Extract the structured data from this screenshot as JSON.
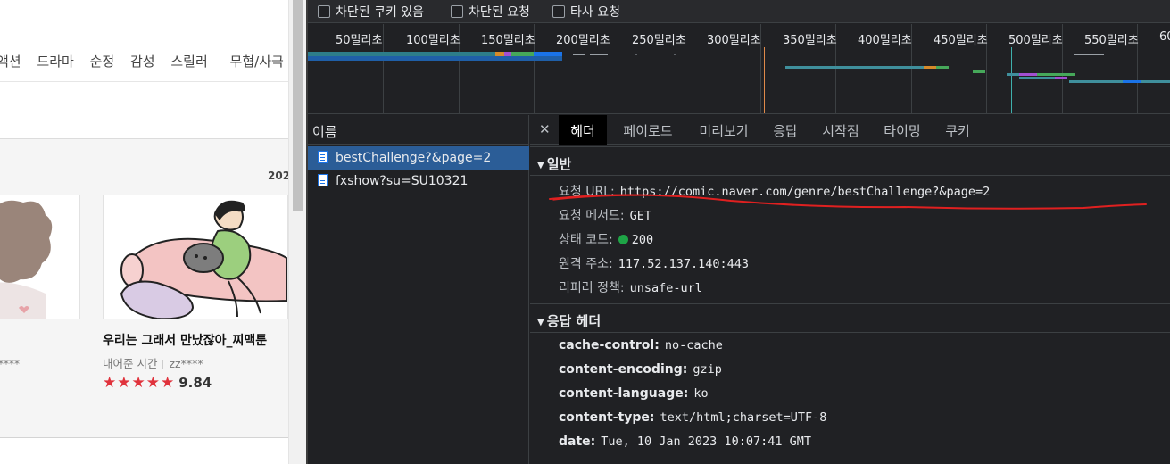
{
  "webpage": {
    "genres": [
      "액션",
      "드라마",
      "순정",
      "감성",
      "스릴러",
      "무협/사극"
    ],
    "year_partial": "202",
    "card1": {
      "author_partial": "****"
    },
    "card2": {
      "title": "우리는 그래서 만났잖아_찌맥툰",
      "author": "내어준 시간",
      "user": "zz****",
      "stars": "★★★★★",
      "rating": "9.84"
    }
  },
  "devtools": {
    "filters": [
      {
        "label": "차단된 쿠키 있음",
        "checked": false
      },
      {
        "label": "차단된 요청",
        "checked": false
      },
      {
        "label": "타사 요청",
        "checked": false
      }
    ],
    "timeline_ticks": [
      "50밀리초",
      "100밀리초",
      "150밀리초",
      "200밀리초",
      "250밀리초",
      "300밀리초",
      "350밀리초",
      "400밀리초",
      "450밀리초",
      "500밀리초",
      "550밀리초",
      "60"
    ],
    "name_column_header": "이름",
    "requests": [
      {
        "name": "bestChallenge?&page=2",
        "selected": true
      },
      {
        "name": "fxshow?su=SU10321",
        "selected": false
      }
    ],
    "detail_tabs": [
      "헤더",
      "페이로드",
      "미리보기",
      "응답",
      "시작점",
      "타이밍",
      "쿠키"
    ],
    "active_tab": "헤더",
    "general": {
      "title": "일반",
      "fields": [
        {
          "key": "요청 URL:",
          "value": "https://comic.naver.com/genre/bestChallenge?&page=2"
        },
        {
          "key": "요청 메서드:",
          "value": "GET"
        },
        {
          "key": "상태 코드:",
          "value": "200"
        },
        {
          "key": "원격 주소:",
          "value": "117.52.137.140:443"
        },
        {
          "key": "리퍼러 정책:",
          "value": "unsafe-url"
        }
      ]
    },
    "response_headers": {
      "title": "응답 헤더",
      "fields": [
        {
          "key": "cache-control:",
          "value": "no-cache"
        },
        {
          "key": "content-encoding:",
          "value": "gzip"
        },
        {
          "key": "content-language:",
          "value": "ko"
        },
        {
          "key": "content-type:",
          "value": "text/html;charset=UTF-8"
        },
        {
          "key": "date:",
          "value": "Tue, 10 Jan 2023 10:07:41 GMT"
        }
      ]
    },
    "colors": {
      "panel_bg": "#202124",
      "selected_row": "#2b5d97",
      "status_ok": "#1ea446",
      "annotation": "#e02020"
    }
  }
}
